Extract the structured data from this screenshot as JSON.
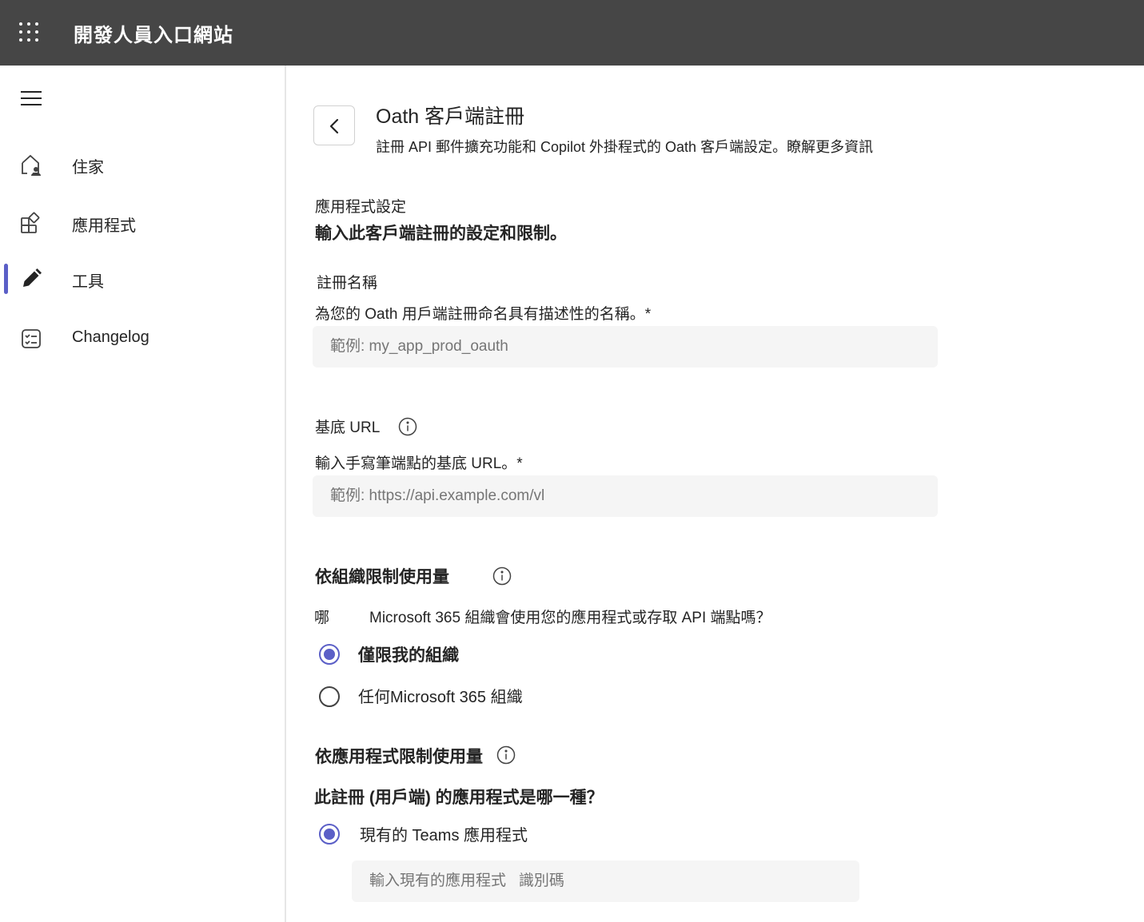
{
  "header": {
    "app_title": "開發人員入口網站",
    "waffle_icon": "app-launcher-icon"
  },
  "sidebar": {
    "menu_icon": "hamburger-icon",
    "items": [
      {
        "label": "住家",
        "icon": "home-icon",
        "active": false
      },
      {
        "label": "應用程式",
        "icon": "apps-icon",
        "active": false
      },
      {
        "label": "工具",
        "icon": "pencil-icon",
        "active": true
      },
      {
        "label": "Changelog",
        "icon": "checklist-icon",
        "active": false
      }
    ],
    "accent_color": "#5b5fc7"
  },
  "page": {
    "title": "Oath 客戶端註冊",
    "description": "註冊 API 郵件擴充功能和 Copilot 外掛程式的 Oath 客戶端設定。",
    "learn_more": "瞭解更多資訊"
  },
  "app_settings": {
    "title": "應用程式設定",
    "subtitle": "輸入此客戶端註冊的設定和限制。"
  },
  "registration_name": {
    "label": "註冊名稱",
    "help": "為您的 Oath 用戶端註冊命名具有描述性的名稱。*",
    "placeholder": "範例: my_app_prod_oauth"
  },
  "base_url": {
    "label": "基底 URL",
    "help": "輸入手寫筆端點的基底 URL。*",
    "placeholder": "範例: https://api.example.com/vl"
  },
  "org_restriction": {
    "heading": "依組織限制使用量",
    "question_prefix": "哪",
    "question": "Microsoft 365 組織會使用您的應用程式或存取 API 端點嗎？",
    "options": [
      {
        "label": "僅限我的組織",
        "selected": true
      },
      {
        "label": "任何Microsoft 365 組織",
        "selected": false
      }
    ]
  },
  "app_restriction": {
    "heading": "依應用程式限制使用量",
    "question": "此註冊 (用戶端) 的應用程式是哪一種？",
    "options": [
      {
        "label": "現有的 Teams 應用程式",
        "selected": true
      }
    ],
    "app_id_placeholder": "輸入現有的應用程式   識別碼"
  }
}
